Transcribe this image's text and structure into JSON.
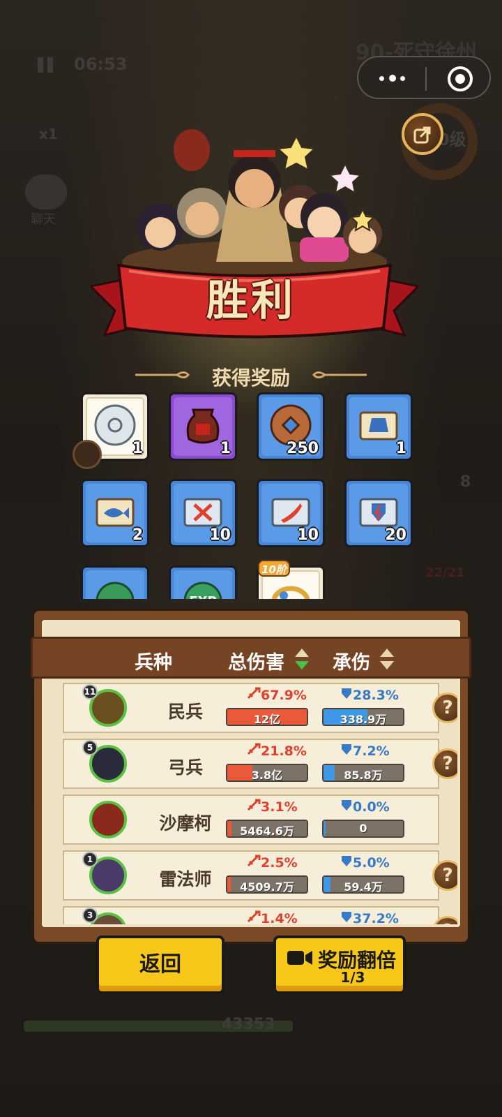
{
  "hud": {
    "time": "06:53",
    "speed": "x1",
    "chat_label": "聊天",
    "level_title": "90-死守徐州",
    "ring_label": "0级",
    "wave_count": "43353",
    "side_count": "8",
    "side_troops": "22/21"
  },
  "result": {
    "title": "胜利",
    "rewards_header": "获得奖励"
  },
  "rewards": [
    {
      "icon": "silver-disc-icon",
      "rarity": "white",
      "qty": "1"
    },
    {
      "icon": "wine-jar-icon",
      "rarity": "purple",
      "qty": "1"
    },
    {
      "icon": "copper-coin-icon",
      "rarity": "blue",
      "qty": "250"
    },
    {
      "icon": "armor-scroll-icon",
      "rarity": "blue",
      "qty": "1"
    },
    {
      "icon": "fish-scroll-icon",
      "rarity": "blue",
      "qty": "2"
    },
    {
      "icon": "crossed-weapons-scroll-icon",
      "rarity": "blue",
      "qty": "10"
    },
    {
      "icon": "blade-scroll-icon",
      "rarity": "blue",
      "qty": "10"
    },
    {
      "icon": "lightning-shield-scroll-icon",
      "rarity": "blue",
      "qty": "20"
    },
    {
      "icon": "jade-orb-icon",
      "rarity": "blue",
      "qty": ""
    },
    {
      "icon": "exp-orb-icon",
      "rarity": "blue",
      "qty": ""
    },
    {
      "icon": "gold-ring-icon",
      "rarity": "white",
      "qty": "",
      "badge": "10阶"
    }
  ],
  "stats": {
    "headers": {
      "unit": "兵种",
      "damage": "总伤害",
      "taken": "承伤"
    },
    "rows": [
      {
        "level": "11",
        "name": "民兵",
        "dmg_pct": "67.9%",
        "dmg_val": "12亿",
        "dmg_ratio": 1.0,
        "taken_pct": "28.3%",
        "taken_val": "338.9万",
        "taken_ratio": 0.55,
        "help": true
      },
      {
        "level": "5",
        "name": "弓兵",
        "dmg_pct": "21.8%",
        "dmg_val": "3.8亿",
        "dmg_ratio": 0.32,
        "taken_pct": "7.2%",
        "taken_val": "85.8万",
        "taken_ratio": 0.14,
        "help": true
      },
      {
        "level": "",
        "name": "沙摩柯",
        "dmg_pct": "3.1%",
        "dmg_val": "5464.6万",
        "dmg_ratio": 0.05,
        "taken_pct": "0.0%",
        "taken_val": "0",
        "taken_ratio": 0.0,
        "help": false
      },
      {
        "level": "1",
        "name": "雷法师",
        "dmg_pct": "2.5%",
        "dmg_val": "4509.7万",
        "dmg_ratio": 0.04,
        "taken_pct": "5.0%",
        "taken_val": "59.4万",
        "taken_ratio": 0.09,
        "help": true
      },
      {
        "level": "3",
        "name": "",
        "dmg_pct": "1.4%",
        "dmg_val": "",
        "dmg_ratio": 0.02,
        "taken_pct": "37.2%",
        "taken_val": "",
        "taken_ratio": 0.6,
        "help": true
      }
    ]
  },
  "buttons": {
    "back": "返回",
    "double": "奖励翻倍",
    "double_count": "1/3"
  },
  "help_glyph": "?"
}
